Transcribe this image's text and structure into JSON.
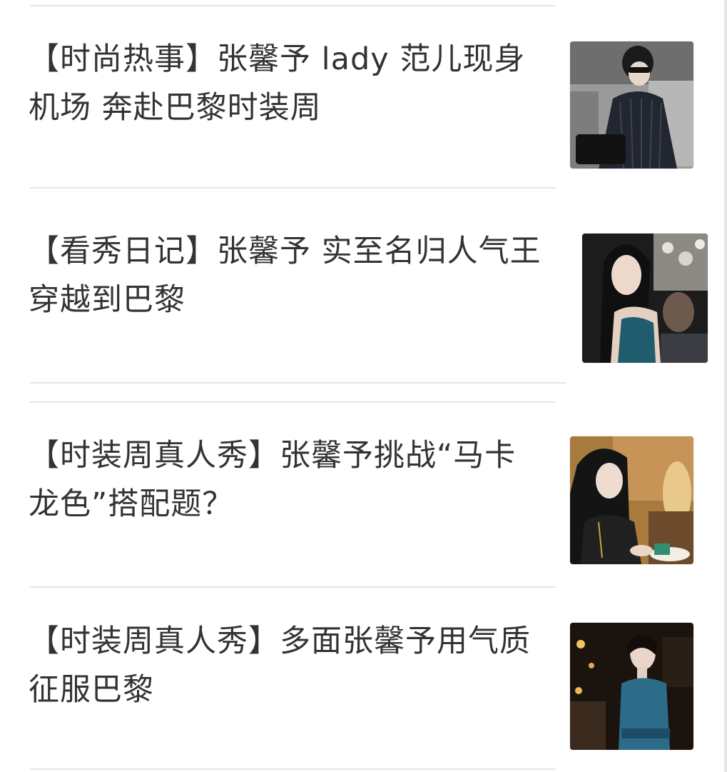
{
  "articles": [
    {
      "title": "【时尚热事】张馨予 lady 范儿现身机场 奔赴巴黎时装周",
      "thumbnail": "photo-airport-icon"
    },
    {
      "title": "【看秀日记】张馨予 实至名归人气王穿越到巴黎",
      "thumbnail": "photo-show-icon"
    },
    {
      "title": "【时装周真人秀】张馨予挑战“马卡龙色”搭配题？",
      "thumbnail": "photo-cafe-icon"
    },
    {
      "title": "【时装周真人秀】多面张馨予用气质征服巴黎",
      "thumbnail": "photo-night-icon"
    }
  ],
  "colors": {
    "title_text": "#333333",
    "divider": "#e6e6e6",
    "background": "#ffffff"
  }
}
